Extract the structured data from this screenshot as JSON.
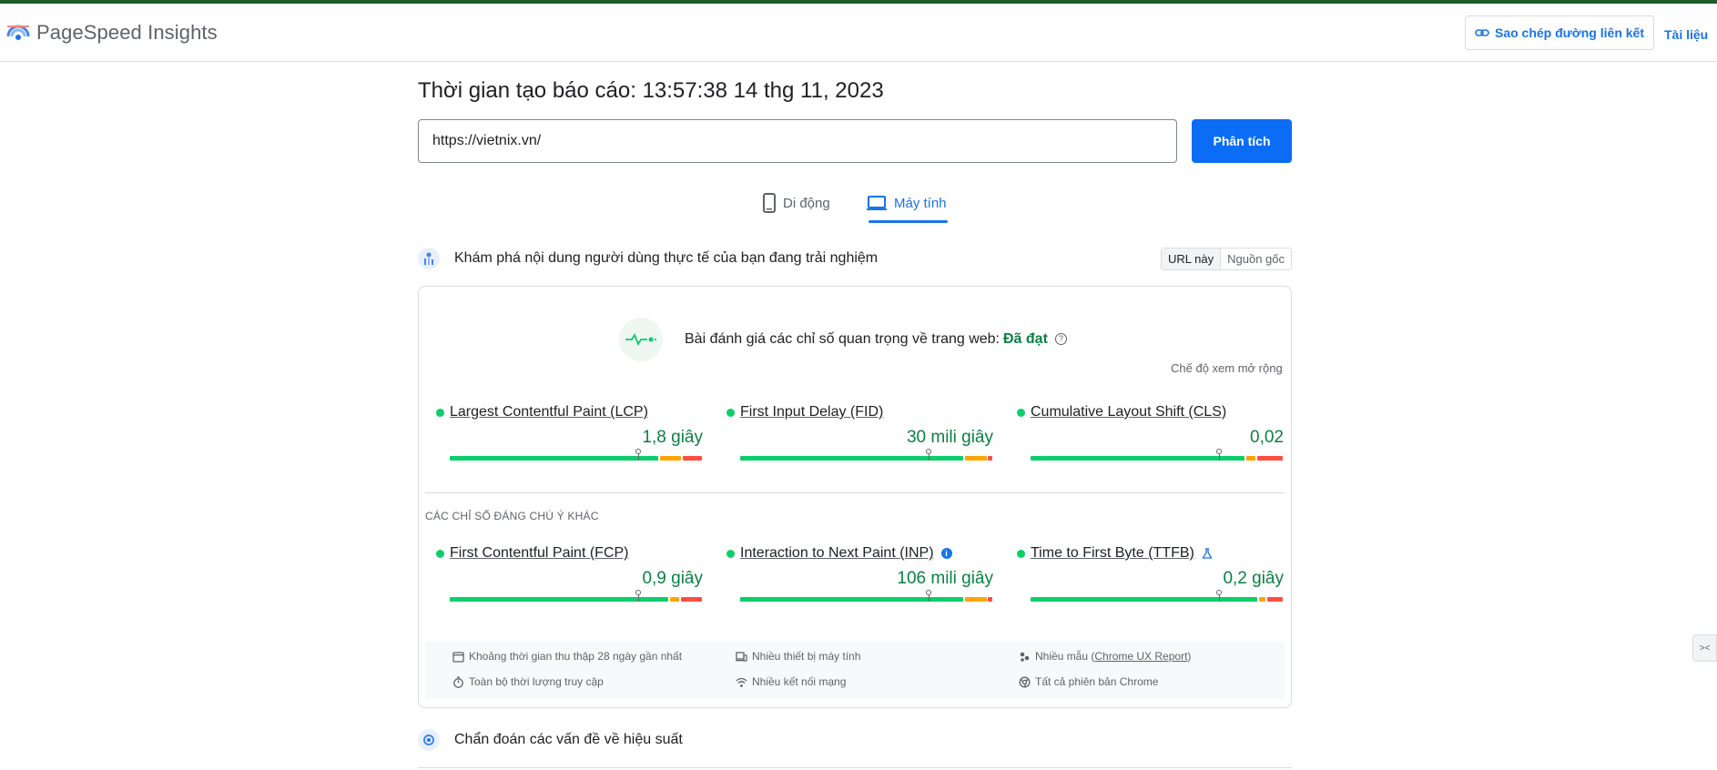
{
  "header": {
    "app_title": "PageSpeed Insights",
    "copy_link_label": "Sao chép đường liên kết",
    "docs_label": "Tài liệu"
  },
  "report": {
    "title": "Thời gian tạo báo cáo: 13:57:38 14 thg 11, 2023",
    "url_value": "https://vietnix.vn/",
    "analyze_label": "Phân tích"
  },
  "tabs": [
    {
      "label": "Di động",
      "active": false
    },
    {
      "label": "Máy tính",
      "active": true
    }
  ],
  "field_section": {
    "heading": "Khám phá nội dung người dùng thực tế của bạn đang trải nghiệm",
    "toggle": [
      "URL này",
      "Nguồn gốc"
    ],
    "assessment_text": "Bài đánh giá các chỉ số quan trọng về trang web:",
    "assessment_status": "Đã đạt",
    "expand_label": "Chế độ xem mở rộng",
    "core_metrics": [
      {
        "name": "Largest Contentful Paint (LCP)",
        "value": "1,8 giây"
      },
      {
        "name": "First Input Delay (FID)",
        "value": "30 mili giây"
      },
      {
        "name": "Cumulative Layout Shift (CLS)",
        "value": "0,02"
      }
    ],
    "other_label": "CÁC CHỈ SỐ ĐÁNG CHÚ Ý KHÁC",
    "other_metrics": [
      {
        "name": "First Contentful Paint (FCP)",
        "value": "0,9 giây"
      },
      {
        "name": "Interaction to Next Paint (INP)",
        "value": "106 mili giây"
      },
      {
        "name": "Time to First Byte (TTFB)",
        "value": "0,2 giây"
      }
    ],
    "info": {
      "period": "Khoảng thời gian thu thập 28 ngày gần nhất",
      "devices": "Nhiều thiết bị máy tính",
      "samples_prefix": "Nhiều mẫu (",
      "samples_link": "Chrome UX Report",
      "samples_suffix": ")",
      "duration": "Toàn bộ thời lượng truy cập",
      "network": "Nhiều kết nối mạng",
      "chrome": "Tất cả phiên bản Chrome"
    }
  },
  "diagnose_section": {
    "heading": "Chẩn đoán các vấn đề về hiệu suất"
  },
  "colors": {
    "accent": "#1a73e8",
    "good": "#0cce6b",
    "average": "#ffa400",
    "poor": "#ff4e42",
    "pass_text": "#0b8043"
  }
}
